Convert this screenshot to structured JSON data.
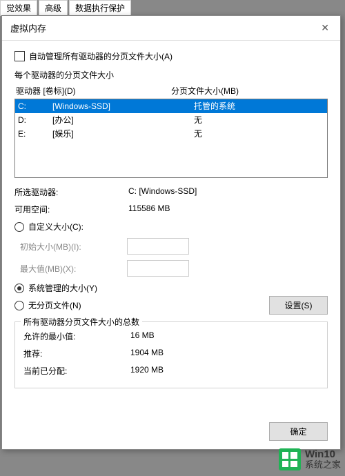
{
  "bg_tabs": [
    "觉效果",
    "高级",
    "数据执行保护"
  ],
  "dialog": {
    "title": "虚拟内存",
    "auto_manage_label": "自动管理所有驱动器的分页文件大小(A)",
    "per_drive_label": "每个驱动器的分页文件大小",
    "headers": {
      "drive": "驱动器 [卷标](D)",
      "size": "分页文件大小(MB)"
    },
    "drives": [
      {
        "letter": "C:",
        "label": "[Windows-SSD]",
        "size": "托管的系统",
        "selected": true
      },
      {
        "letter": "D:",
        "label": "[办公]",
        "size": "无",
        "selected": false
      },
      {
        "letter": "E:",
        "label": "[娱乐]",
        "size": "无",
        "selected": false
      }
    ],
    "selected_drive_label": "所选驱动器:",
    "selected_drive_value": "C:  [Windows-SSD]",
    "free_space_label": "可用空间:",
    "free_space_value": "115586 MB",
    "custom_size_label": "自定义大小(C):",
    "initial_size_label": "初始大小(MB)(I):",
    "max_size_label": "最大值(MB)(X):",
    "system_managed_label": "系统管理的大小(Y)",
    "no_pagefile_label": "无分页文件(N)",
    "set_button": "设置(S)",
    "totals_legend": "所有驱动器分页文件大小的总数",
    "min_allowed_label": "允许的最小值:",
    "min_allowed_value": "16 MB",
    "recommended_label": "推荐:",
    "recommended_value": "1904 MB",
    "allocated_label": "当前已分配:",
    "allocated_value": "1920 MB",
    "ok_button": "确定"
  },
  "watermark": {
    "line1": "Win10",
    "line2": "系统之家"
  }
}
